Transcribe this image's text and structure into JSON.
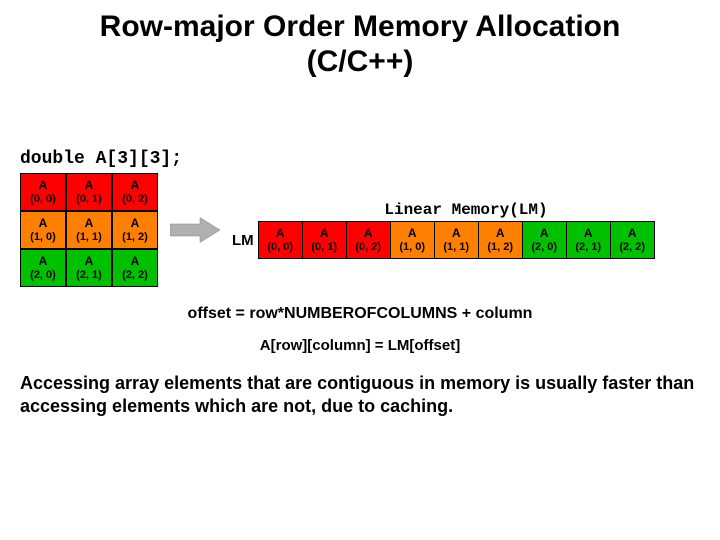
{
  "title_line1": "Row-major Order Memory Allocation",
  "title_line2": "(C/C++)",
  "declaration": "double A[3][3];",
  "matrix": [
    [
      {
        "label": "A",
        "idx": "(0, 0)",
        "color": "c-red"
      },
      {
        "label": "A",
        "idx": "(0, 1)",
        "color": "c-red"
      },
      {
        "label": "A",
        "idx": "(0, 2)",
        "color": "c-red"
      }
    ],
    [
      {
        "label": "A",
        "idx": "(1, 0)",
        "color": "c-orange"
      },
      {
        "label": "A",
        "idx": "(1, 1)",
        "color": "c-orange"
      },
      {
        "label": "A",
        "idx": "(1, 2)",
        "color": "c-orange"
      }
    ],
    [
      {
        "label": "A",
        "idx": "(2, 0)",
        "color": "c-green"
      },
      {
        "label": "A",
        "idx": "(2, 1)",
        "color": "c-green"
      },
      {
        "label": "A",
        "idx": "(2, 2)",
        "color": "c-green"
      }
    ]
  ],
  "lm_title": "Linear Memory(LM)",
  "lm_label": "LM",
  "lm_cells": [
    {
      "label": "A",
      "idx": "(0, 0)",
      "color": "c-red"
    },
    {
      "label": "A",
      "idx": "(0, 1)",
      "color": "c-red"
    },
    {
      "label": "A",
      "idx": "(0, 2)",
      "color": "c-red"
    },
    {
      "label": "A",
      "idx": "(1, 0)",
      "color": "c-orange"
    },
    {
      "label": "A",
      "idx": "(1, 1)",
      "color": "c-orange"
    },
    {
      "label": "A",
      "idx": "(1, 2)",
      "color": "c-orange"
    },
    {
      "label": "A",
      "idx": "(2, 0)",
      "color": "c-green"
    },
    {
      "label": "A",
      "idx": "(2, 1)",
      "color": "c-green"
    },
    {
      "label": "A",
      "idx": "(2, 2)",
      "color": "c-green"
    }
  ],
  "formula1": "offset = row*NUMBEROFCOLUMNS + column",
  "formula2": "A[row][column] = LM[offset]",
  "caption": "Accessing array elements that are contiguous in memory is usually faster than accessing elements which are not, due to caching."
}
